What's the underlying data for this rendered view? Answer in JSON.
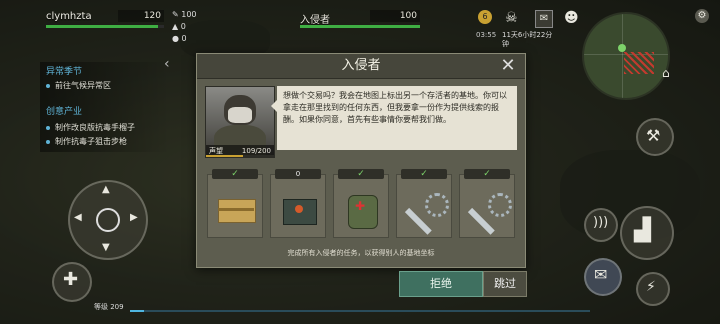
{
  "player": {
    "name": "clymhzta",
    "level": "120",
    "health_fill": 0.95,
    "stat1": "100",
    "stat2": "0",
    "stat3": "0"
  },
  "enemy": {
    "name": "入侵者",
    "hp": "100",
    "hp_fill": 1.0
  },
  "top_status": {
    "time": "03:55",
    "day_line1": "11天6小时22分",
    "day_line2": "钟",
    "badge": "6"
  },
  "quests": {
    "header1": "异常季节",
    "item1": "前往气候异常区",
    "header2": "创意产业",
    "item2": "制作改良版抗毒手榴子",
    "item3": "制作抗毒子狙击步枪"
  },
  "dialog": {
    "title": "入侵者",
    "speaker": "声望",
    "speaker_value": "109/200",
    "speech": "想做个交易吗？我会在地图上标出另一个存活者的基地。你可以拿走在那里找到的任何东西，但我要拿一份作为提供线索的报酬。如果你同意，首先有些事情你要帮我们做。",
    "items": [
      {
        "name": "supply-crate",
        "status": "done",
        "label": "✓"
      },
      {
        "name": "explosive-charge",
        "status": "count",
        "label": "0"
      },
      {
        "name": "medic-backpack",
        "status": "done",
        "label": "✓"
      },
      {
        "name": "saw-machete",
        "status": "done",
        "label": "✓"
      },
      {
        "name": "saw-machete-2",
        "status": "done",
        "label": "✓"
      }
    ],
    "footer": "完成所有入侵者的任务，以获得别人的基地坐标",
    "reject_label": "拒绝",
    "skip_label": "跳过"
  },
  "bottom": {
    "level_text": "等级 209",
    "xp_fill": 0.03
  },
  "colors": {
    "accent_blue": "#5fb3d6",
    "health_green": "#3fae43",
    "reject_green": "#3f7060"
  }
}
